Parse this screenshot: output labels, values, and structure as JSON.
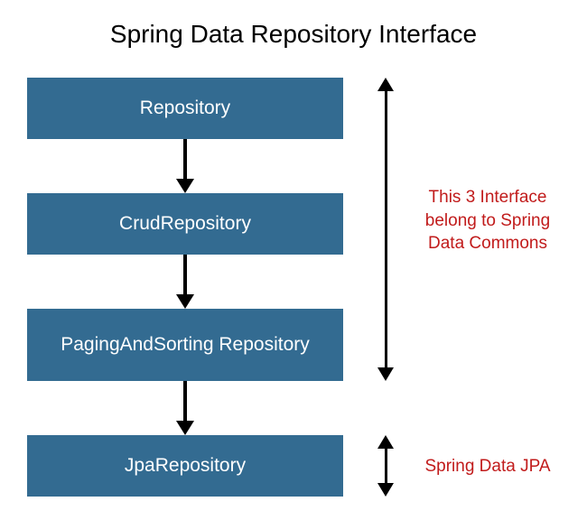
{
  "title": "Spring Data Repository Interface",
  "boxes": {
    "b1": "Repository",
    "b2": "CrudRepository",
    "b3": "PagingAndSorting Repository",
    "b4": "JpaRepository"
  },
  "notes": {
    "n1": "This 3 Interface belong to Spring Data Commons",
    "n2": "Spring Data JPA"
  }
}
